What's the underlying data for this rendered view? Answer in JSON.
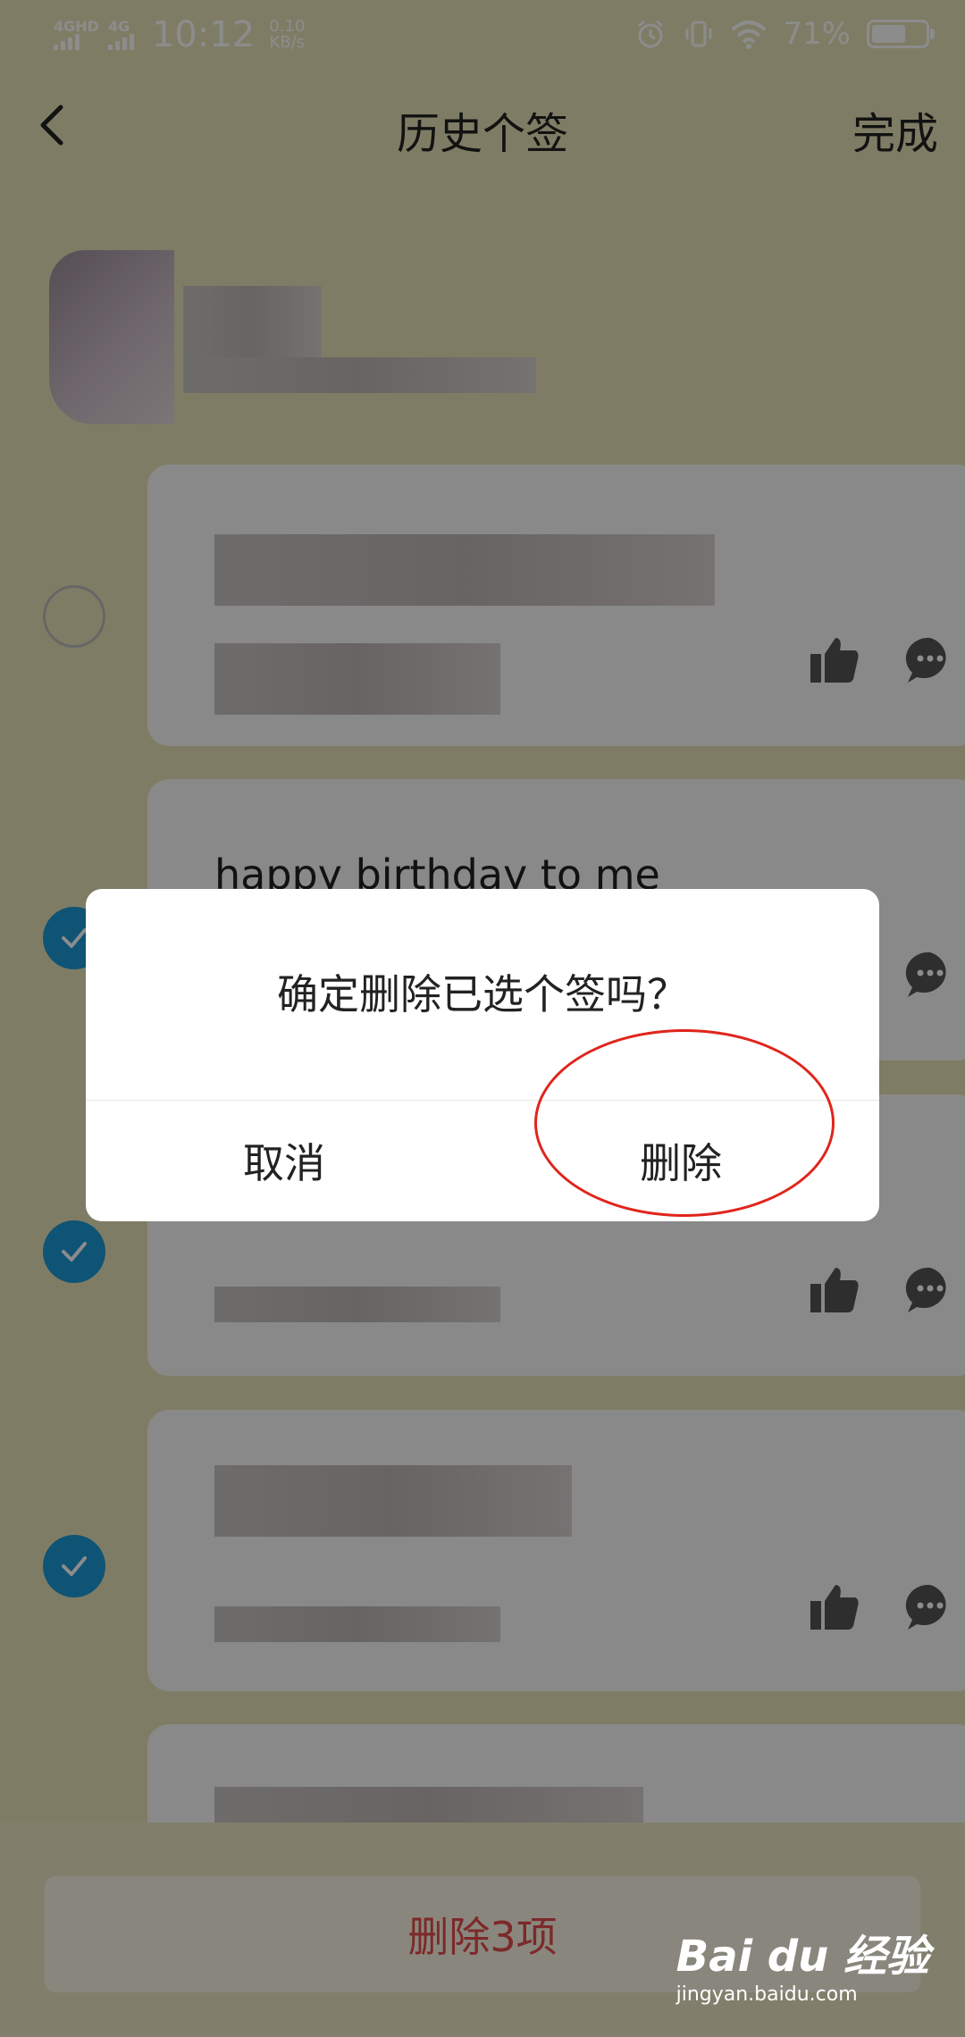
{
  "status_bar": {
    "signal1": "4GHD",
    "signal2": "4G",
    "time": "10:12",
    "speed_value": "0.10",
    "speed_unit": "KB/s",
    "battery_pct": "71%",
    "battery_level": 0.71
  },
  "nav": {
    "title": "历史个签",
    "done_label": "完成"
  },
  "cards": [
    {
      "text": "",
      "checked": false
    },
    {
      "text": "happy birthday to me",
      "checked": true
    },
    {
      "text": "",
      "checked": true
    },
    {
      "text": "",
      "checked": true
    }
  ],
  "bottom_bar": {
    "delete_label": "删除3项"
  },
  "dialog": {
    "message": "确定删除已选个签吗？",
    "cancel_label": "取消",
    "delete_label": "删除"
  },
  "watermark": {
    "brand": "Bai du 经验",
    "url": "jingyan.baidu.com"
  },
  "colors": {
    "accent_check": "#1d9ad6",
    "delete_red": "#e34b4b",
    "highlight_ring": "#e0251b"
  }
}
